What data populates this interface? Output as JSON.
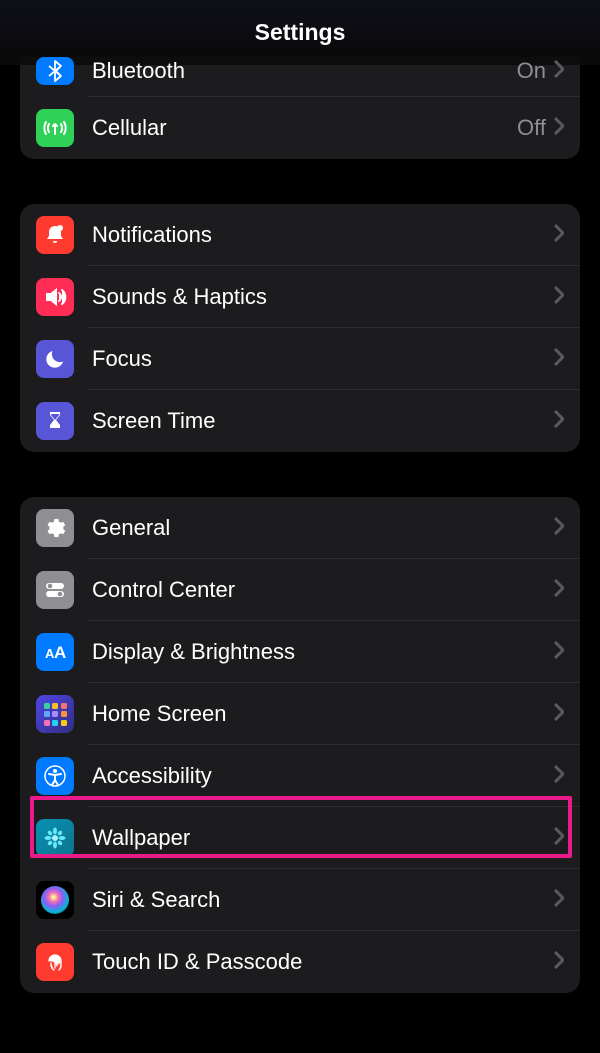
{
  "header": {
    "title": "Settings"
  },
  "annotation": {
    "highlight_row_name": "row-accessibility",
    "color": "#eb1a8a"
  },
  "sections": {
    "connectivity": {
      "bluetooth": {
        "label": "Bluetooth",
        "value": "On"
      },
      "cellular": {
        "label": "Cellular",
        "value": "Off"
      }
    },
    "alerts": {
      "notifications": {
        "label": "Notifications"
      },
      "sounds": {
        "label": "Sounds & Haptics"
      },
      "focus": {
        "label": "Focus"
      },
      "screentime": {
        "label": "Screen Time"
      }
    },
    "general": {
      "general": {
        "label": "General"
      },
      "controlcenter": {
        "label": "Control Center"
      },
      "display": {
        "label": "Display & Brightness"
      },
      "homescreen": {
        "label": "Home Screen"
      },
      "accessibility": {
        "label": "Accessibility"
      },
      "wallpaper": {
        "label": "Wallpaper"
      },
      "siri": {
        "label": "Siri & Search"
      },
      "touchid": {
        "label": "Touch ID & Passcode"
      }
    }
  },
  "colors": {
    "blue": "#007aff",
    "green": "#30d158",
    "red": "#ff3b30",
    "orange": "#ff453a",
    "indigo": "#5856d6",
    "gray": "#8e8e93",
    "pink": "#ff2d55"
  }
}
